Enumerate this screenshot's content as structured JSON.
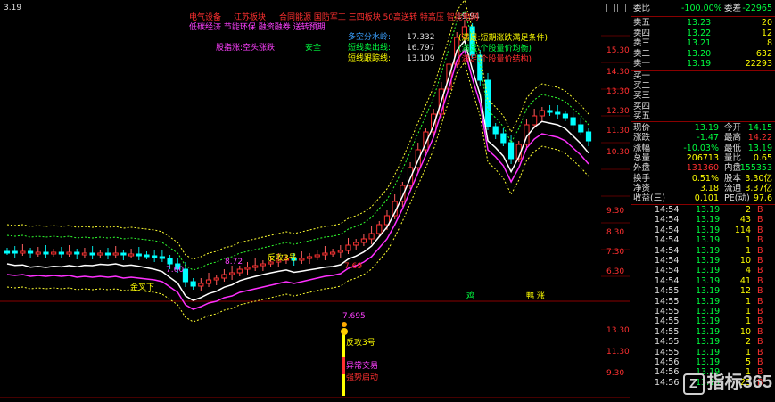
{
  "chart": {
    "corner_label": "3.19",
    "peak_label": "19.94",
    "top_flags": [
      "电气设备",
      "江苏板块",
      "合同能源 国防军工 三四板块 50高送转 特高压 智能电网",
      "低碳经济 节能环保 融资融券 送转预期"
    ],
    "overlay_indicators": [
      {
        "label": "多空分水岭:",
        "value": "17.332"
      },
      {
        "label": "短线卖出线:",
        "value": "16.797"
      },
      {
        "label": "短线跟踪线:",
        "value": "13.109"
      }
    ],
    "left_notes": [
      "股指涨:空头涨跌",
      "安全"
    ],
    "annotations": [
      "(满足:短期涨跌满足条件)",
      "(满足:个股量价均衡)",
      "(满足:个股量价结构)"
    ],
    "chart_marks": [
      "反攻3号",
      "7.69",
      "7.60",
      "8.72",
      "金叉下",
      "鸡",
      "鸭 涨"
    ],
    "sub_marks": [
      "7.695",
      "反攻3号",
      "异常交易",
      "强势启动"
    ],
    "price_scale": [
      "15.30",
      "14.30",
      "13.30",
      "12.30",
      "11.30",
      "10.30",
      "9.30",
      "8.30",
      "7.30",
      "6.30",
      "13.30",
      "11.30",
      "9.30"
    ]
  },
  "panel": {
    "ratio": {
      "label": "委比",
      "pct": "-100.00%",
      "diff_label": "委差",
      "diff": "-22965"
    },
    "asks": [
      {
        "label": "卖五",
        "price": "13.23",
        "vol": "20"
      },
      {
        "label": "卖四",
        "price": "13.22",
        "vol": "12"
      },
      {
        "label": "卖三",
        "price": "13.21",
        "vol": "8"
      },
      {
        "label": "卖二",
        "price": "13.20",
        "vol": "632"
      },
      {
        "label": "卖一",
        "price": "13.19",
        "vol": "22293"
      }
    ],
    "bids": [
      "买一",
      "买二",
      "买三",
      "买四",
      "买五"
    ],
    "stats": [
      {
        "l1": "现价",
        "v1": "13.19",
        "l2": "今开",
        "v2": "14.15"
      },
      {
        "l1": "涨跌",
        "v1": "-1.47",
        "l2": "最高",
        "v2": "14.22"
      },
      {
        "l1": "涨幅",
        "v1": "-10.03%",
        "l2": "最低",
        "v2": "13.19"
      },
      {
        "l1": "总量",
        "v1": "206713",
        "l2": "量比",
        "v2": "0.65"
      },
      {
        "l1": "外盘",
        "v1": "131360",
        "l2": "内盘",
        "v2": "155353"
      },
      {
        "l1": "换手",
        "v1": "0.51%",
        "l2": "股本",
        "v2": "3.30亿"
      },
      {
        "l1": "净资",
        "v1": "3.18",
        "l2": "流通",
        "v2": "3.37亿"
      },
      {
        "l1": "收益(三)",
        "v1": "0.101",
        "l2": "PE(动)",
        "v2": "97.6"
      }
    ],
    "ticks": [
      {
        "t": "14:54",
        "p": "13.19",
        "v": "2",
        "d": "B"
      },
      {
        "t": "14:54",
        "p": "13.19",
        "v": "43",
        "d": "B"
      },
      {
        "t": "14:54",
        "p": "13.19",
        "v": "114",
        "d": "B"
      },
      {
        "t": "14:54",
        "p": "13.19",
        "v": "1",
        "d": "B"
      },
      {
        "t": "14:54",
        "p": "13.19",
        "v": "1",
        "d": "B"
      },
      {
        "t": "14:54",
        "p": "13.19",
        "v": "10",
        "d": "B"
      },
      {
        "t": "14:54",
        "p": "13.19",
        "v": "4",
        "d": "B"
      },
      {
        "t": "14:54",
        "p": "13.19",
        "v": "41",
        "d": "B"
      },
      {
        "t": "14:55",
        "p": "13.19",
        "v": "12",
        "d": "B"
      },
      {
        "t": "14:55",
        "p": "13.19",
        "v": "1",
        "d": "B"
      },
      {
        "t": "14:55",
        "p": "13.19",
        "v": "1",
        "d": "B"
      },
      {
        "t": "14:55",
        "p": "13.19",
        "v": "1",
        "d": "B"
      },
      {
        "t": "14:55",
        "p": "13.19",
        "v": "10",
        "d": "B"
      },
      {
        "t": "14:55",
        "p": "13.19",
        "v": "2",
        "d": "B"
      },
      {
        "t": "14:55",
        "p": "13.19",
        "v": "1",
        "d": "B"
      },
      {
        "t": "14:56",
        "p": "13.19",
        "v": "5",
        "d": "B"
      },
      {
        "t": "14:56",
        "p": "13.19",
        "v": "1",
        "d": "B"
      },
      {
        "t": "14:56",
        "p": "13.19",
        "v": "23",
        "d": "B"
      }
    ],
    "watermark": "指标365"
  }
}
